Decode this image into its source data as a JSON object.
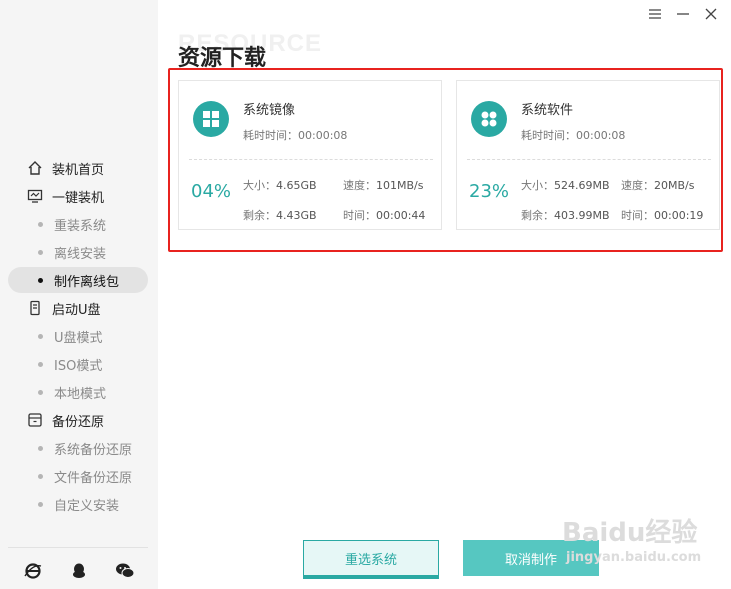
{
  "window": {
    "controls": [
      "menu",
      "minimize",
      "close"
    ]
  },
  "sidebar": {
    "items": [
      {
        "label": "装机首页",
        "type": "top",
        "icon": "home-icon"
      },
      {
        "label": "一键装机",
        "type": "top",
        "icon": "monitor-icon"
      },
      {
        "label": "重装系统",
        "type": "sub"
      },
      {
        "label": "离线安装",
        "type": "sub"
      },
      {
        "label": "制作离线包",
        "type": "sub",
        "active": true
      },
      {
        "label": "启动U盘",
        "type": "top",
        "icon": "usb-icon"
      },
      {
        "label": "U盘模式",
        "type": "sub"
      },
      {
        "label": "ISO模式",
        "type": "sub"
      },
      {
        "label": "本地模式",
        "type": "sub"
      },
      {
        "label": "备份还原",
        "type": "top",
        "icon": "backup-icon"
      },
      {
        "label": "系统备份还原",
        "type": "sub"
      },
      {
        "label": "文件备份还原",
        "type": "sub"
      },
      {
        "label": "自定义安装",
        "type": "sub"
      }
    ],
    "footer_icons": [
      "ie-icon",
      "qq-icon",
      "wechat-icon"
    ]
  },
  "header": {
    "watermark": "RESOURCE",
    "title": "资源下载"
  },
  "cards": [
    {
      "name": "系统镜像",
      "icon": "windows-icon",
      "elapsed_label": "耗时时间：",
      "elapsed": "00:00:08",
      "percent": "04%",
      "size_label": "大小：",
      "size": "4.65GB",
      "speed_label": "速度：",
      "speed": "101MB/s",
      "remain_label": "剩余：",
      "remain": "4.43GB",
      "time_label": "时间：",
      "time": "00:00:44"
    },
    {
      "name": "系统软件",
      "icon": "apps-icon",
      "elapsed_label": "耗时时间：",
      "elapsed": "00:00:08",
      "percent": "23%",
      "size_label": "大小：",
      "size": "524.69MB",
      "speed_label": "速度：",
      "speed": "20MB/s",
      "remain_label": "剩余：",
      "remain": "403.99MB",
      "time_label": "时间：",
      "time": "00:00:19"
    }
  ],
  "buttons": {
    "reselect": "重选系统",
    "cancel": "取消制作"
  },
  "watermark": {
    "line1": "Baidu经验",
    "line2": "jingyan.baidu.com"
  },
  "colors": {
    "accent": "#2aa9a3",
    "highlight": "#e8231f",
    "sidebar_bg": "#f5f5f5"
  }
}
